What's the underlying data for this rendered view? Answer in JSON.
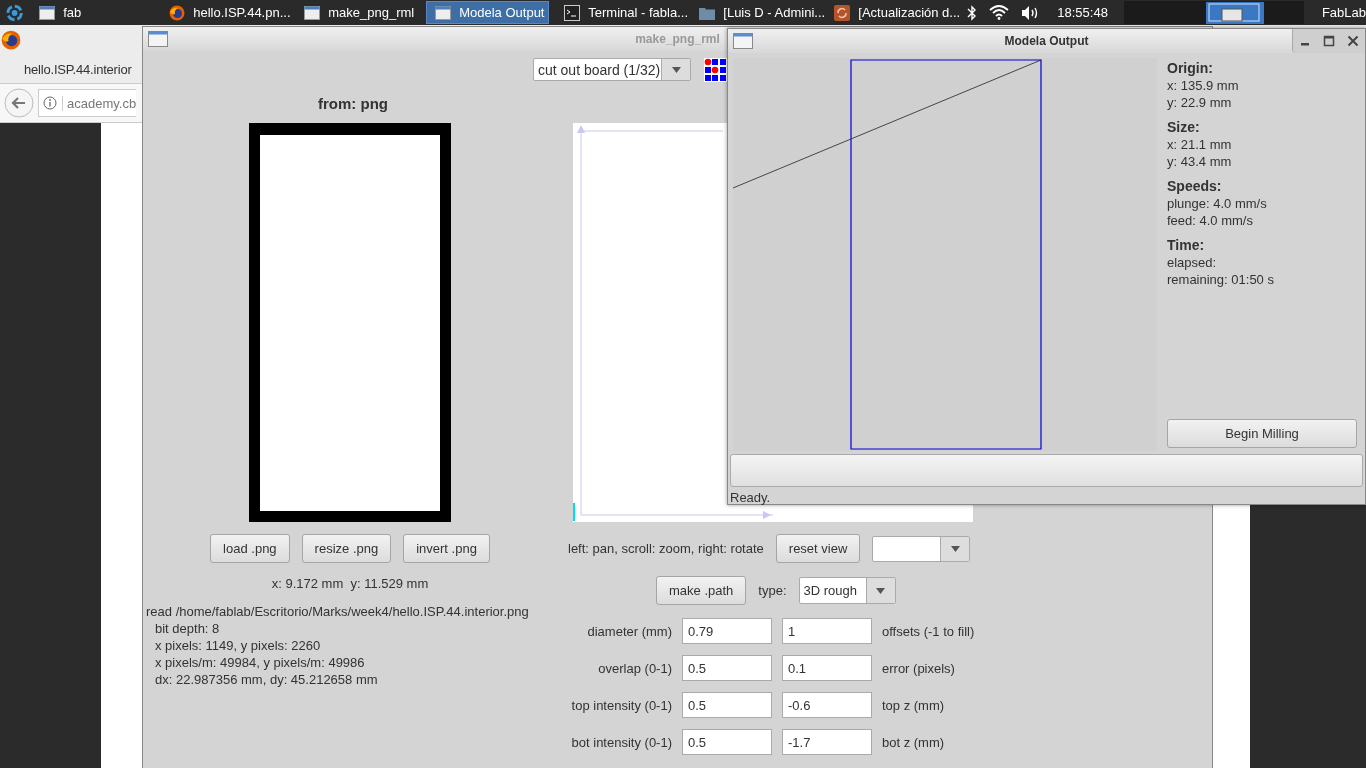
{
  "taskbar": {
    "items": [
      {
        "label": "fab",
        "kind": "window",
        "selected": false
      },
      {
        "label": "hello.ISP.44.pn...",
        "kind": "firefox",
        "selected": false
      },
      {
        "label": "make_png_rml",
        "kind": "window",
        "selected": false
      },
      {
        "label": "Modela Output",
        "kind": "window",
        "selected": true
      },
      {
        "label": "Terminal - fabla...",
        "kind": "terminal",
        "selected": false
      },
      {
        "label": "[Luis D - Admini...",
        "kind": "folder",
        "selected": false
      },
      {
        "label": "[Actualización d...",
        "kind": "update",
        "selected": false
      }
    ],
    "clock": "18:55:48",
    "user": "FabLab"
  },
  "browser": {
    "tab": "hello.ISP.44.interior",
    "url": "academy.cb"
  },
  "make_window": {
    "title": "make_png_rml",
    "mode": "cut out board (1/32)",
    "from_title": "from: png",
    "buttons": [
      "load .png",
      "resize .png",
      "invert .png"
    ],
    "coords": "x: 9.172 mm  y: 11.529 mm",
    "read_line": "read /home/fablab/Escritorio/Marks/week4/hello.ISP.44.interior.png",
    "details": [
      "bit depth: 8",
      "x pixels: 1149, y pixels: 2260",
      "x pixels/m: 49984, y pixels/m: 49986",
      "dx: 22.987356 mm, dy: 45.212658 mm"
    ],
    "view_hint": "left: pan, scroll: zoom, right: rotate",
    "reset_button": "reset view",
    "make_button": "make .path",
    "type_label": "type:",
    "type": "3D rough",
    "params": [
      {
        "label": "diameter (mm)",
        "value": "0.79",
        "value2": "1",
        "label2": "offsets (-1 to fill)"
      },
      {
        "label": "overlap (0-1)",
        "value": "0.5",
        "value2": "0.1",
        "label2": "error (pixels)"
      },
      {
        "label": "top intensity (0-1)",
        "value": "0.5",
        "value2": "-0.6",
        "label2": "top z (mm)"
      },
      {
        "label": "bot intensity (0-1)",
        "value": "0.5",
        "value2": "-1.7",
        "label2": "bot z (mm)"
      }
    ]
  },
  "modela": {
    "title": "Modela Output",
    "sections": [
      {
        "heading": "Origin:",
        "lines": [
          "x: 135.9 mm",
          "y: 22.9 mm"
        ]
      },
      {
        "heading": "Size:",
        "lines": [
          "x: 21.1 mm",
          "y: 43.4 mm"
        ]
      },
      {
        "heading": "Speeds:",
        "lines": [
          "plunge: 4.0 mm/s",
          "feed: 4.0 mm/s"
        ]
      },
      {
        "heading": "Time:",
        "lines": [
          "elapsed:",
          "remaining: 01:50 s"
        ]
      }
    ],
    "button": "Begin Milling",
    "progress": {
      "level": 0
    },
    "status": "Ready."
  }
}
